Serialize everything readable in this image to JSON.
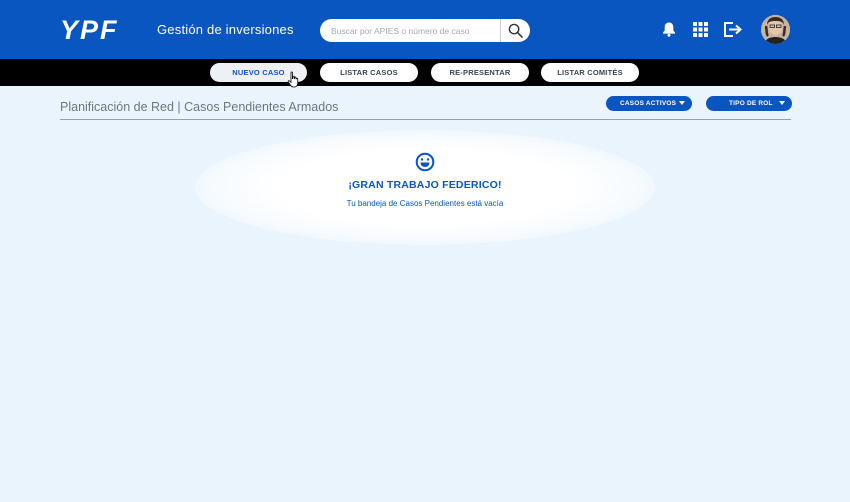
{
  "header": {
    "logo_text": "YPF",
    "app_title": "Gestión de inversiones",
    "search_placeholder": "Buscar por APIES o número de caso",
    "icons": [
      "search-icon",
      "bell-icon",
      "apps-grid-icon",
      "logout-icon"
    ],
    "colors": {
      "brand_blue": "#0a56c0"
    }
  },
  "nav": {
    "items": [
      {
        "label": "NUEVO CASO",
        "active": true
      },
      {
        "label": "LISTAR CASOS",
        "active": false
      },
      {
        "label": "RE-PRESENTAR",
        "active": false
      },
      {
        "label": "LISTAR COMITÉS",
        "active": false
      }
    ]
  },
  "page": {
    "title": "Planificación de Red | Casos Pendientes Armados",
    "filters": [
      {
        "label": "CASOS ACTIVOS"
      },
      {
        "label": "TIPO DE ROL"
      }
    ]
  },
  "empty_state": {
    "icon": "smile-icon",
    "title": "¡GRAN TRABAJO FEDERICO!",
    "message": "Tu bandeja de Casos Pendientes está vacía"
  }
}
